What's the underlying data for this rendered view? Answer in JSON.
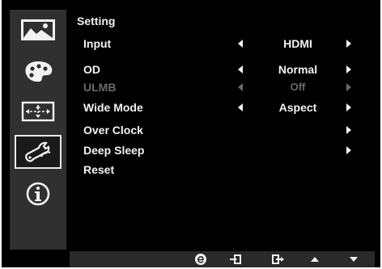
{
  "menu": {
    "title": "Setting",
    "items": [
      {
        "label": "Input",
        "value": "HDMI",
        "arrows": true,
        "enabled": true
      },
      {
        "label": "OD",
        "value": "Normal",
        "arrows": true,
        "enabled": true
      },
      {
        "label": "ULMB",
        "value": "Off",
        "arrows": true,
        "enabled": false
      },
      {
        "label": "Wide Mode",
        "value": "Aspect",
        "arrows": true,
        "enabled": true
      },
      {
        "label": "Over Clock",
        "value": "",
        "arrows": "right",
        "enabled": true
      },
      {
        "label": "Deep Sleep",
        "value": "",
        "arrows": "right",
        "enabled": true
      },
      {
        "label": "Reset",
        "value": "",
        "arrows": false,
        "enabled": true
      }
    ]
  },
  "sidebar": {
    "icons": [
      "picture-icon",
      "color-palette-icon",
      "display-position-icon",
      "settings-wrench-icon",
      "information-icon"
    ],
    "selected": "settings-wrench-icon"
  },
  "bottom_bar": {
    "buttons": [
      "e-key-icon",
      "enter-icon",
      "exit-icon",
      "up-arrow-icon",
      "down-arrow-icon"
    ]
  },
  "colors": {
    "background": "#000000",
    "sidebar": "#303030",
    "text": "#f2f2f2",
    "disabled_text": "#6a6a6a"
  }
}
